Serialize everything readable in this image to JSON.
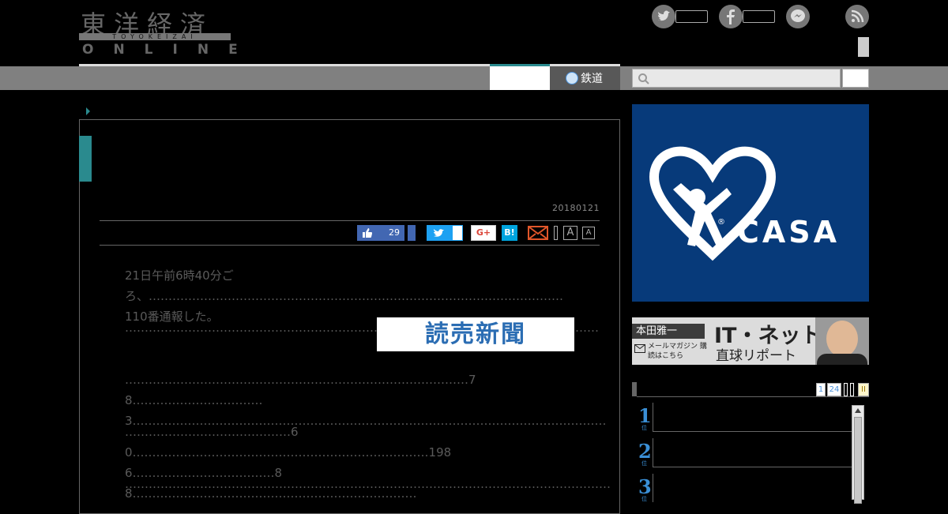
{
  "header": {
    "logo_kanji": "東洋経済",
    "logo_sub": "TOYOKEIZAI",
    "logo_online": "ONLINE"
  },
  "nav": {
    "rail_tab_label": "鉄道",
    "search_placeholder": ""
  },
  "article": {
    "date": "20180121",
    "share": {
      "like_count": "29",
      "gplus_label": "G+",
      "hatena_label": "B!",
      "font_large_label": "A",
      "font_small_label": "A"
    },
    "paragraphs": [
      "21日午前6時40分ごろ、……………………………………………………………………………………………110番通報した。",
      "…………………………………………………………………………………………………………",
      "……………………………………………………………………………78……………………………3…………………………………………………………………………………………………………",
      "……………………………………60…………………………………………………………………1986………………………………88………………………………………………………………",
      "……………………………………………………………………………………………………………"
    ]
  },
  "ads": {
    "yomiuri_label": "読売新聞",
    "casa_label": "CASA",
    "casa_reg": "®",
    "honda_name": "本田雅一",
    "honda_title": "IT・ネット",
    "honda_subtitle": "直球リポート",
    "honda_mail_text": "メールマガジン 購読はこちら"
  },
  "ranking": {
    "tabs": [
      "1",
      "24",
      "",
      "",
      "II"
    ],
    "items": [
      {
        "num": "1",
        "sub": "位"
      },
      {
        "num": "2",
        "sub": "位"
      },
      {
        "num": "3",
        "sub": "位"
      }
    ]
  },
  "colors": {
    "accent": "#2a8a8e",
    "facebook": "#4267b2",
    "twitter": "#1da1f2",
    "casa_bg": "#073a7a"
  }
}
